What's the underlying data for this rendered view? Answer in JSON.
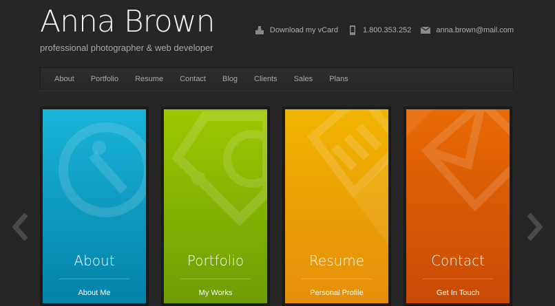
{
  "header": {
    "name": "Anna Brown",
    "tagline": "professional photographer & web developer",
    "vcard": "Download my vCard",
    "phone": "1.800.353.252",
    "email": "anna.brown@mail.com"
  },
  "nav": {
    "items": [
      "About",
      "Portfolio",
      "Resume",
      "Contact",
      "Blog",
      "Clients",
      "Sales",
      "Plans"
    ]
  },
  "cards": [
    {
      "title": "About",
      "subtitle": "About Me",
      "color_top": "#19b3d9",
      "color_bottom": "#0482a8",
      "icon": "magnifier-icon"
    },
    {
      "title": "Portfolio",
      "subtitle": "My Works",
      "color_top": "#9ec800",
      "color_bottom": "#6e9c06",
      "icon": "tag-icon"
    },
    {
      "title": "Resume",
      "subtitle": "Personal Profile",
      "color_top": "#f1b400",
      "color_bottom": "#e58e0b",
      "icon": "document-icon"
    },
    {
      "title": "Contact",
      "subtitle": "Get In Touch",
      "color_top": "#e86a05",
      "color_bottom": "#c84a05",
      "icon": "envelope-icon"
    }
  ],
  "arrows": {
    "prev": "chevron-left-icon",
    "next": "chevron-right-icon"
  }
}
